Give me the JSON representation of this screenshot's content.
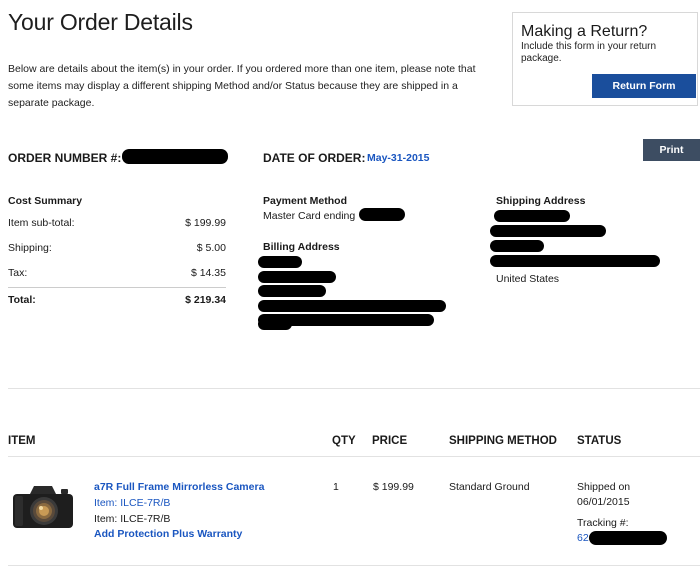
{
  "page": {
    "title": "Your Order Details",
    "intro": "Below are details about the item(s) in your order. If you ordered more than one item, please note that some items may display a different shipping Method and/or Status because they are shipped in a separate package."
  },
  "return_box": {
    "title": "Making a Return?",
    "subtitle": "Include this form in your return package.",
    "button_label": "Return Form"
  },
  "print_label": "Print",
  "order": {
    "number_label": "ORDER NUMBER #:",
    "date_label": "DATE OF ORDER:",
    "date_value": "May-31-2015"
  },
  "cost_summary": {
    "heading": "Cost Summary",
    "rows": [
      {
        "label": "Item sub-total:",
        "value": "$ 199.99"
      },
      {
        "label": "Shipping:",
        "value": "$ 5.00"
      },
      {
        "label": "Tax:",
        "value": "$ 14.35"
      }
    ],
    "total_label": "Total:",
    "total_value": "$ 219.34"
  },
  "payment": {
    "heading": "Payment Method",
    "value": "Master Card ending"
  },
  "billing": {
    "heading": "Billing Address"
  },
  "shipping_address": {
    "heading": "Shipping Address",
    "country": "United States"
  },
  "items_table": {
    "headers": [
      "ITEM",
      "QTY",
      "PRICE",
      "SHIPPING METHOD",
      "STATUS"
    ],
    "row": {
      "name": "a7R Full Frame Mirrorless Camera",
      "item_link": "Item: ILCE-7R/B",
      "item_plain": "Item: ILCE-7R/B",
      "protection": "Add Protection Plus Warranty",
      "qty": "1",
      "price": "$ 199.99",
      "shipping_method": "Standard Ground",
      "status_line1": "Shipped on",
      "status_line2": "06/01/2015",
      "tracking_label": "Tracking #:",
      "tracking_prefix": "62"
    }
  },
  "colors": {
    "accent_blue": "#1a56c0",
    "return_button": "#1a4e9c",
    "print_button": "#3d4d62"
  }
}
